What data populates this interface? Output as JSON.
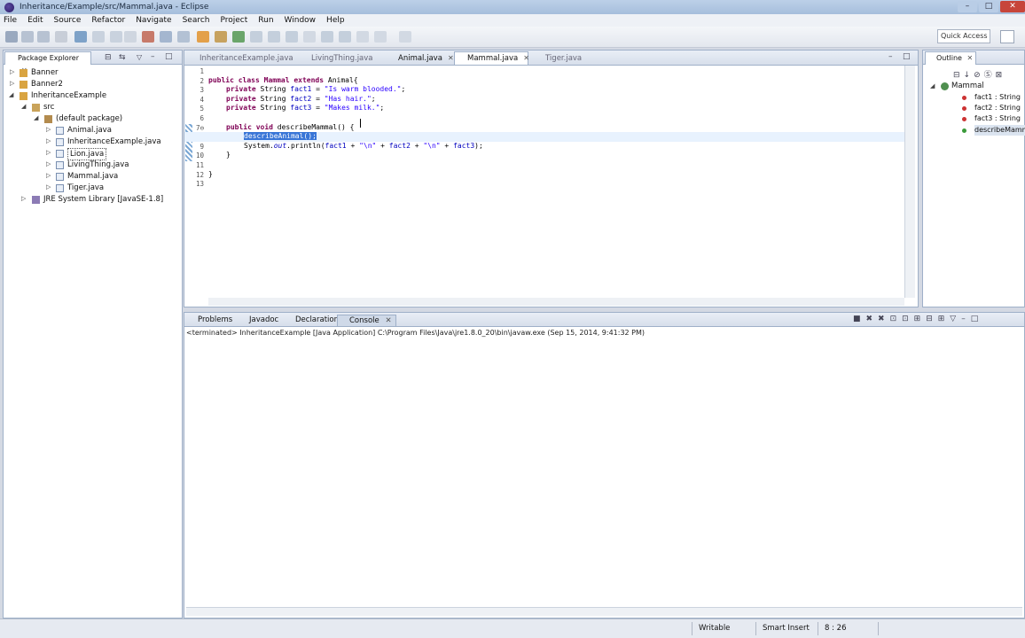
{
  "window": {
    "title": "Inheritance/Example/src/Mammal.java - Eclipse",
    "controls": {
      "minimize": "–",
      "maximize": "□",
      "close": "✕"
    }
  },
  "menu": [
    "File",
    "Edit",
    "Source",
    "Refactor",
    "Navigate",
    "Search",
    "Project",
    "Run",
    "Window",
    "Help"
  ],
  "toolbar": {
    "quick_access": "Quick Access"
  },
  "package_explorer": {
    "tab_label": "Package Explorer",
    "items": [
      "Banner",
      "Banner2",
      "InheritanceExample",
      "src",
      "(default package)",
      "Animal.java",
      "InheritanceExample.java",
      "Lion.java",
      "LivingThing.java",
      "Mammal.java",
      "Tiger.java",
      "JRE System Library [JavaSE-1.8]"
    ]
  },
  "editor": {
    "tabs": [
      "InheritanceExample.java",
      "LivingThing.java",
      "Animal.java",
      "Mammal.java",
      "Tiger.java"
    ],
    "line_numbers": [
      "1",
      "2",
      "3",
      "4",
      "5",
      "6",
      "7⊖",
      "8",
      "9",
      "10",
      "11",
      "12",
      "13"
    ],
    "code": {
      "l2_kw": "public class ",
      "l2_name": "Mammal ",
      "l2_kw2": "extends ",
      "l2_rest": "Animal{",
      "l3_kw": "private ",
      "l3_type": "String ",
      "l3_fld": "fact1",
      "l3_eq": " = ",
      "l3_str": "\"Is warm blooded.\"",
      "l3_end": ";",
      "l4_kw": "private ",
      "l4_type": "String ",
      "l4_fld": "fact2",
      "l4_eq": " = ",
      "l4_str": "\"Has hair.\"",
      "l4_end": ";",
      "l5_kw": "private ",
      "l5_type": "String ",
      "l5_fld": "fact3",
      "l5_eq": " = ",
      "l5_str": "\"Makes milk.\"",
      "l5_end": ";",
      "l7_kw": "public void ",
      "l7_rest": "describeMammal() {",
      "l8_sel": "describeAnimal();",
      "l9_a": "System.",
      "l9_out": "out",
      "l9_b": ".println(",
      "l9_f1": "fact1",
      "l9_c": " + ",
      "l9_s1": "\"\\n\"",
      "l9_d": " + ",
      "l9_f2": "fact2",
      "l9_e": " + ",
      "l9_s2": "\"\\n\"",
      "l9_f": " + ",
      "l9_f3": "fact3",
      "l9_g": ");",
      "l10": "}",
      "l12": "}"
    }
  },
  "outline": {
    "tab_label": "Outline",
    "items": [
      "Mammal",
      "fact1 : String",
      "fact2 : String",
      "fact3 : String",
      "describeMammal()"
    ]
  },
  "console": {
    "tabs": [
      "Problems",
      "Javadoc",
      "Declaration",
      "Console"
    ],
    "status_line": "<terminated> InheritanceExample [Java Application] C:\\Program Files\\Java\\jre1.8.0_20\\bin\\javaw.exe (Sep 15, 2014, 9:41:32 PM)"
  },
  "statusbar": {
    "mode": "Writable",
    "insert": "Smart Insert",
    "position": "8 : 26"
  },
  "colors": {
    "keyword": "#7f0055",
    "string": "#2a00ff",
    "field": "#0000c0",
    "selection": "#3875d7"
  }
}
